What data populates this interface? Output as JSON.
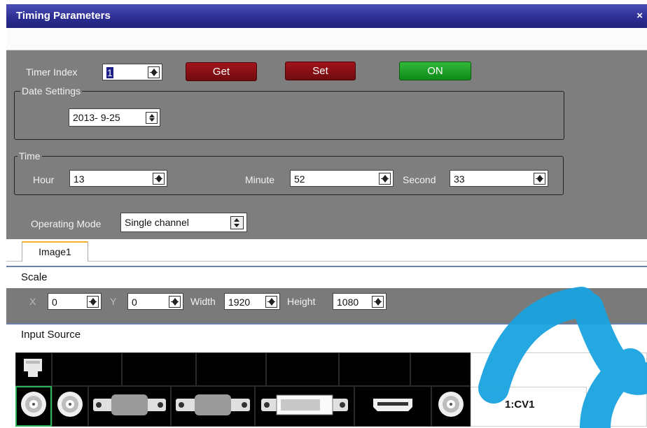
{
  "window": {
    "title": "Timing Parameters",
    "close": "×"
  },
  "timer": {
    "index_label": "Timer Index",
    "index_value": "1",
    "get": "Get",
    "set": "Set",
    "on": "ON"
  },
  "date_settings": {
    "legend": "Date Settings",
    "date": "2013- 9-25"
  },
  "time": {
    "legend": "Time",
    "hour_label": "Hour",
    "hour": "13",
    "minute_label": "Minute",
    "minute": "52",
    "second_label": "Second",
    "second": "33"
  },
  "operating_mode": {
    "label": "Operating Mode",
    "value": "Single channel"
  },
  "tabs": [
    "Image1"
  ],
  "scale": {
    "title": "Scale",
    "x_label": "X",
    "x": "0",
    "y_label": "Y",
    "y": "0",
    "width_label": "Width",
    "width": "1920",
    "height_label": "Height",
    "height": "1080"
  },
  "input_source": {
    "title": "Input Source",
    "channel_label": "1:CV1"
  },
  "colors": {
    "title_bar": "#2a2c90",
    "panel": "#7e7e7e",
    "button_red": "#8a1016",
    "button_green": "#1d9b25",
    "tab_accent": "#f2b13a",
    "watermark": "#1aa3e0"
  }
}
